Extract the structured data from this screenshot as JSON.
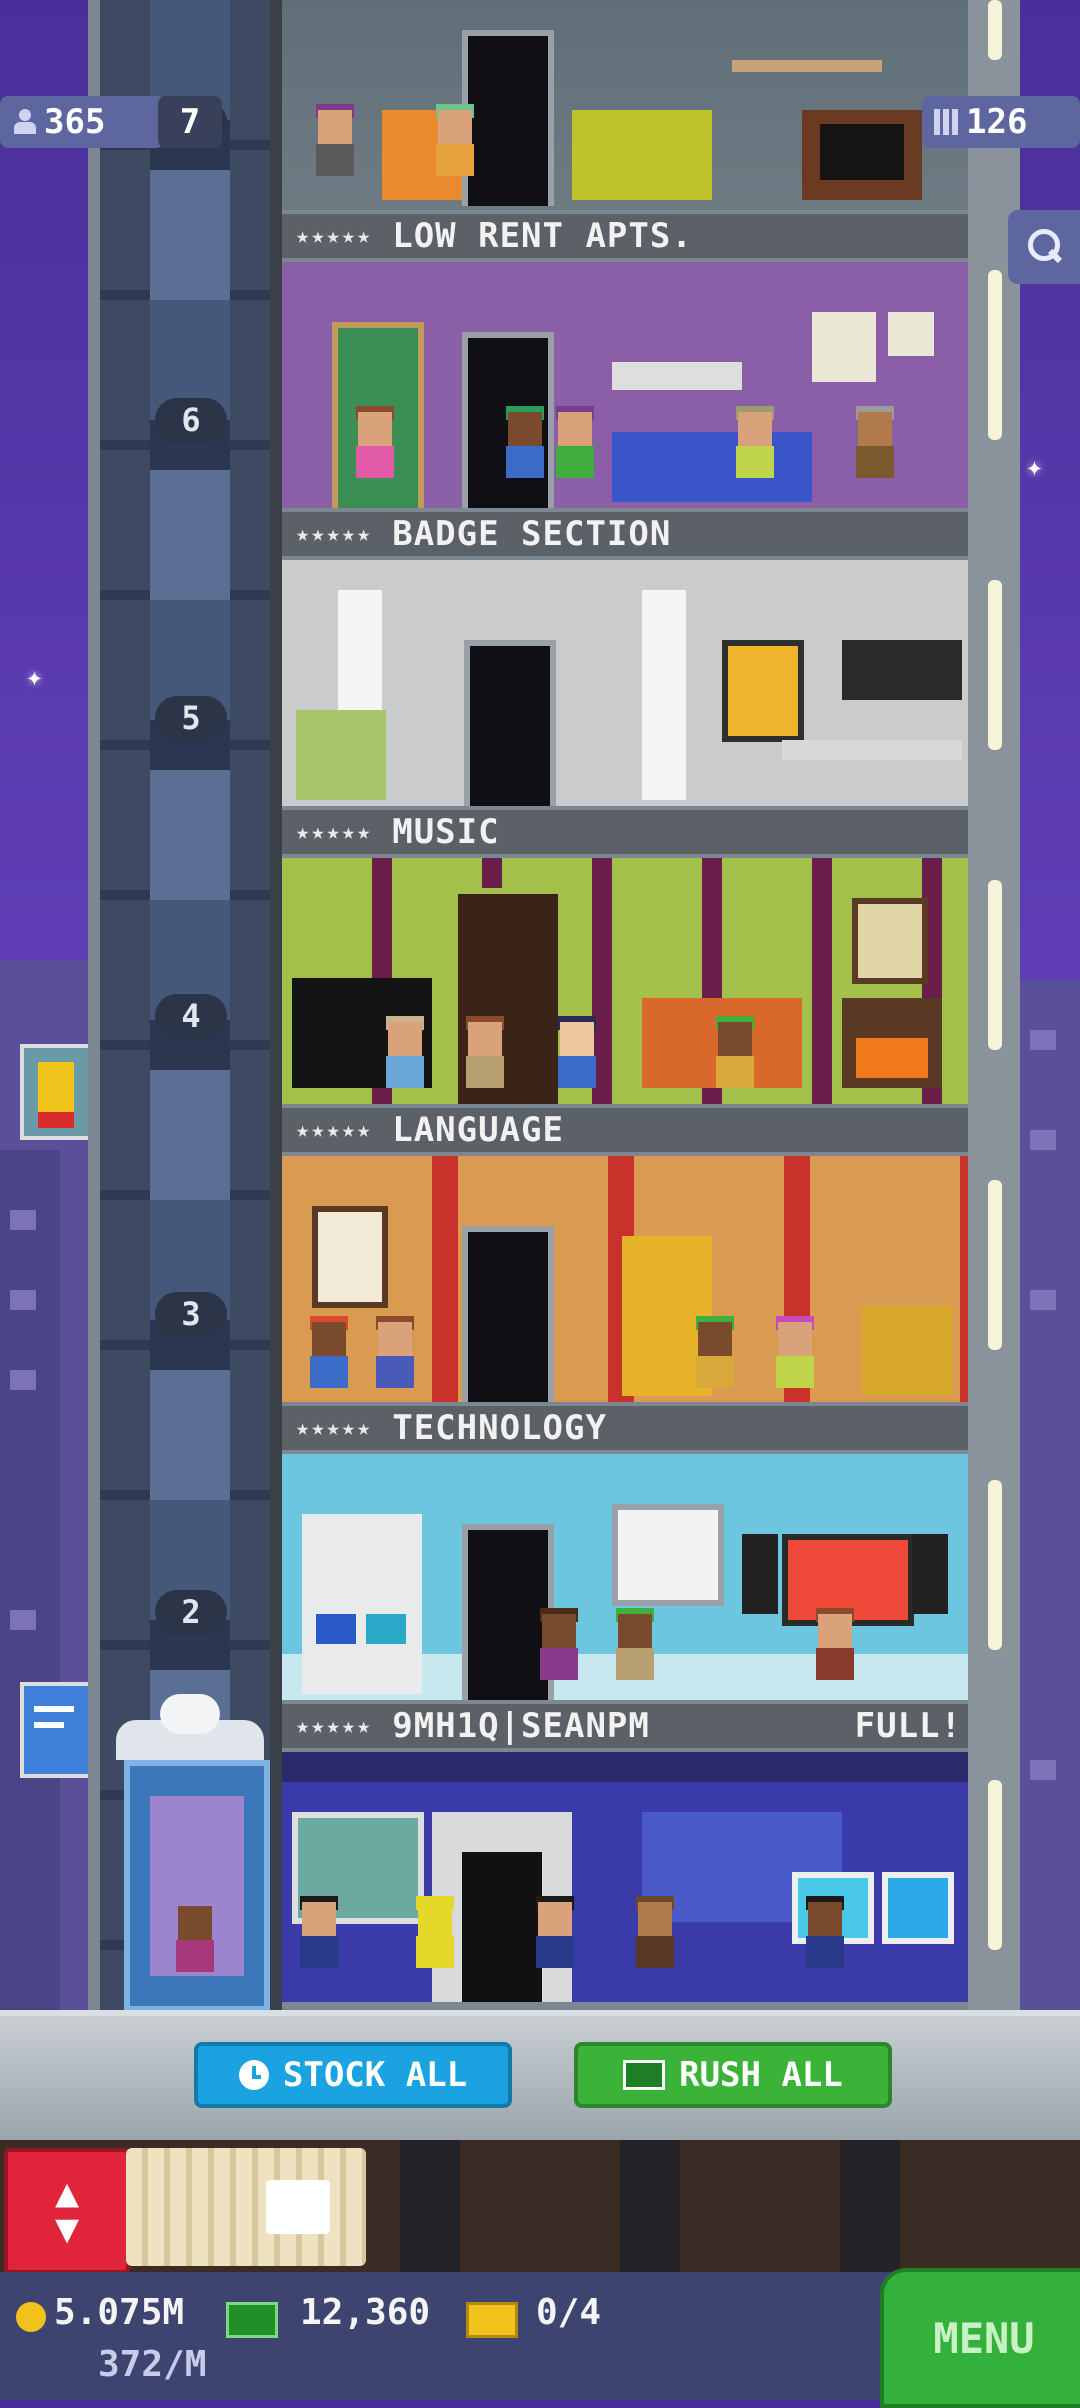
{
  "hud": {
    "population": "365",
    "floor_count": "7",
    "rooms": "126",
    "coins": "5.075M",
    "coin_rate": "372/M",
    "bux": "12,360",
    "tickets": "0/4"
  },
  "floors": [
    {
      "number": "7",
      "name": "LOW RENT APTS.",
      "stars": "★★★★★",
      "status": ""
    },
    {
      "number": "6",
      "name": "BADGE SECTION",
      "stars": "★★★★★",
      "status": ""
    },
    {
      "number": "5",
      "name": "MUSIC",
      "stars": "★★★★★",
      "status": ""
    },
    {
      "number": "4",
      "name": "LANGUAGE",
      "stars": "★★★★★",
      "status": ""
    },
    {
      "number": "3",
      "name": "TECHNOLOGY",
      "stars": "★★★★★",
      "status": ""
    },
    {
      "number": "2",
      "name": "9MH1Q|SEANPM",
      "stars": "★★★★★",
      "status": "FULL!"
    }
  ],
  "actions": {
    "stock_all": "STOCK ALL",
    "rush_all": "RUSH ALL",
    "menu": "MENU"
  },
  "icons": {
    "population": "person-icon",
    "rooms": "building-icon",
    "search": "magnifier-icon",
    "stock": "clock-icon",
    "rush": "bux-icon",
    "elevator": "elevator-arrows-icon",
    "coins": "coin-icon",
    "bux": "bux-icon",
    "tickets": "ticket-icon"
  },
  "colors": {
    "stock_button": "#1aa3e0",
    "rush_button": "#3bb339",
    "menu_button": "#33b13c",
    "elevator_button": "#e0243a"
  }
}
